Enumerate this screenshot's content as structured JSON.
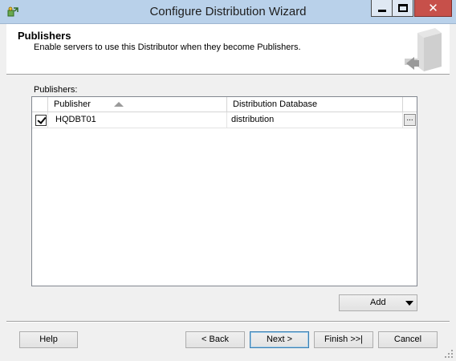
{
  "window": {
    "title": "Configure Distribution Wizard",
    "close_glyph": "✕",
    "app_icon": "wizard-icon"
  },
  "header": {
    "title": "Publishers",
    "subtitle": "Enable servers to use this Distributor when they become Publishers.",
    "art_icon": "server-icon"
  },
  "publishers": {
    "label": "Publishers:",
    "columns": [
      "Publisher",
      "Distribution Database"
    ],
    "sorted_column": "Publisher",
    "sort_direction": "ascending",
    "rows": [
      {
        "checked": true,
        "publisher": "HQDBT01",
        "database": "distribution",
        "browse_label": "..."
      }
    ]
  },
  "buttons": {
    "add": "Add",
    "help": "Help",
    "back": "< Back",
    "next": "Next >",
    "finish": "Finish >>|",
    "cancel": "Cancel"
  },
  "colors": {
    "titlebar": "#b9d1ea",
    "close_button": "#c7504a",
    "default_button_border": "#3c7fb1"
  }
}
